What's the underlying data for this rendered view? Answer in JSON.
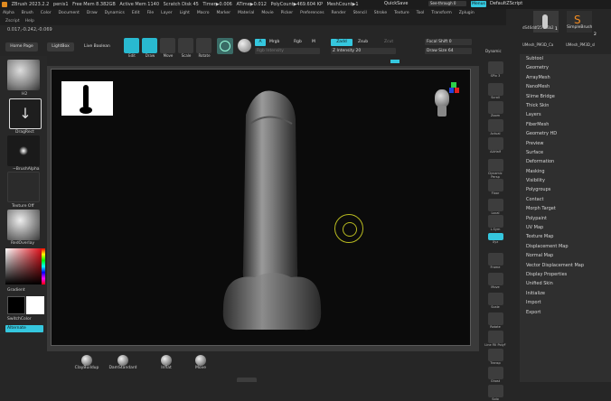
{
  "titlebar": {
    "app": "ZBrush 2023.2.2",
    "doc": "penis1",
    "free_mem": "Free Mem 8.382GB",
    "active_mem": "Active Mem 1140",
    "scratch": "Scratch Disk 45",
    "timer": "Timer▶0.006",
    "atime": "ATime▶0.012",
    "polycount": "PolyCount▶469.604 KP",
    "meshcount": "MeshCount▶1",
    "quicksave": "QuickSave",
    "seethrough": "See-through 0",
    "menus": "Menus",
    "script": "DefaultZScript"
  },
  "menubar": [
    "Alpha",
    "Brush",
    "Color",
    "Document",
    "Draw",
    "Dynamics",
    "Edit",
    "File",
    "Layer",
    "Light",
    "Macro",
    "Marker",
    "Material",
    "Movie",
    "Picker",
    "Preferences",
    "Render",
    "Stencil",
    "Stroke",
    "Texture",
    "Tool",
    "Transform",
    "Zplugin"
  ],
  "scriptbar": [
    "Zscript",
    "Help"
  ],
  "coords": "0.017,-0.242,-0.069",
  "top": {
    "home": "Home Page",
    "lightbox": "LightBox",
    "livebool": "Live Boolean",
    "tools": [
      {
        "label": "Edit",
        "active": true
      },
      {
        "label": "Draw",
        "active": true
      },
      {
        "label": "Move",
        "active": false
      },
      {
        "label": "Scale",
        "active": false
      },
      {
        "label": "Rotate",
        "active": false
      }
    ],
    "a_btn": "A",
    "mrgb": "Mrgb",
    "rgb": "Rgb",
    "m": "M",
    "zadd": "Zadd",
    "zsub": "Zsub",
    "zcut": "Zcut",
    "rgb_intensity": "Rgb Intensity",
    "z_intensity": "Z Intensity 20",
    "focal_shift": "Focal Shift 0",
    "draw_size": "Draw Size 64",
    "dynamic": "Dynamic"
  },
  "tool_thumbs": {
    "subtool_name": "dS46ddf25 8f6b2",
    "simplebrush": "SimpleBrush",
    "count1": "1",
    "count2": "2",
    "subtool_label": "UMesh_PM3D_Ca",
    "subtool_label2": "UMesh_PM3D_sl"
  },
  "left": {
    "brush_label": "H2",
    "stroke_label": "DragRect",
    "alpha_label": "~BrushAlpha",
    "texture_label": "Texture Off",
    "material_label": "RedOverlay",
    "gradient_label": "Gradient",
    "switch_label": "SwitchColor",
    "alternate_label": "Alternate"
  },
  "right": [
    {
      "label": "SPix 3"
    },
    {
      "label": "Scroll"
    },
    {
      "label": "Zoom"
    },
    {
      "label": "Actual"
    },
    {
      "label": "AAHalf"
    },
    {
      "label": "Dynamic Persp"
    },
    {
      "label": "Floor"
    },
    {
      "label": "Local"
    },
    {
      "label": "L.Sym"
    },
    {
      "label": "Xyz"
    },
    {
      "label": "Frame"
    },
    {
      "label": "Move"
    },
    {
      "label": "Scale"
    },
    {
      "label": "Rotate"
    },
    {
      "label": "Line Fill PolyF"
    },
    {
      "label": "Transp"
    },
    {
      "label": "Ghost"
    },
    {
      "label": "Solo"
    }
  ],
  "submenu": [
    "Subtool",
    "Geometry",
    "ArrayMesh",
    "NanoMesh",
    "Slime Bridge",
    "Thick Skin",
    "Layers",
    "FiberMesh",
    "Geometry HD",
    "Preview",
    "Surface",
    "Deformation",
    "Masking",
    "Visibility",
    "Polygroups",
    "Contact",
    "Morph Target",
    "Polypaint",
    "UV Map",
    "Texture Map",
    "Displacement Map",
    "Normal Map",
    "Vector Displacement Map",
    "Display Properties",
    "Unified Skin",
    "Initialize",
    "Import",
    "Export"
  ],
  "bottom_brushes": [
    "ClayBuildup",
    "DamStandard",
    "Inflat",
    "Move"
  ],
  "colors": {
    "accent": "#35c7de",
    "canvas": "#0b0b0b",
    "panel": "#2f2f2f"
  }
}
